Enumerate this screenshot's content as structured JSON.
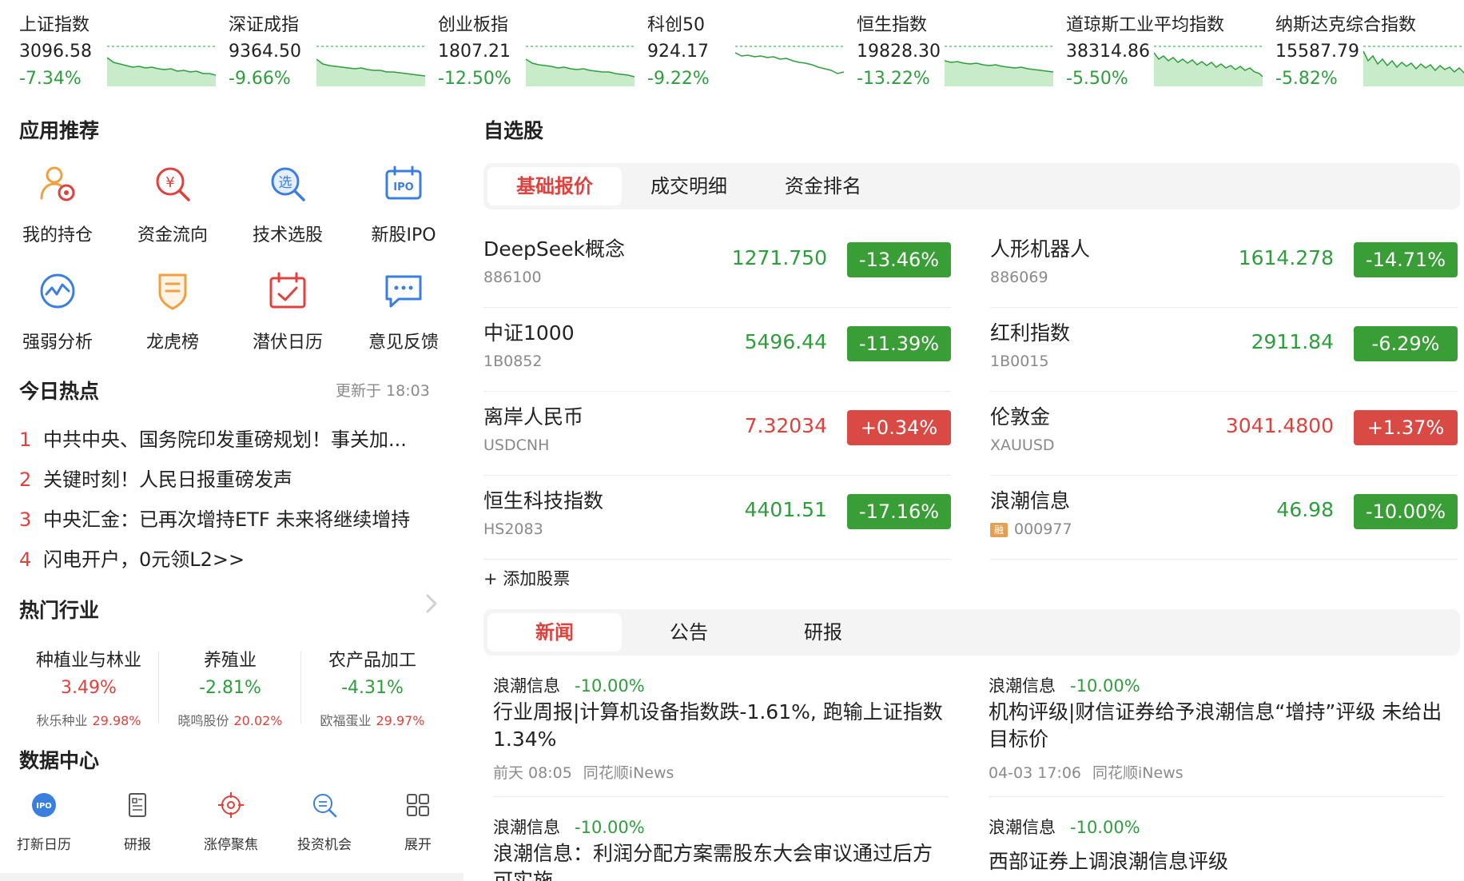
{
  "indices": [
    {
      "name": "上证指数",
      "value": "3096.58",
      "change": "-7.34%"
    },
    {
      "name": "深证成指",
      "value": "9364.50",
      "change": "-9.66%"
    },
    {
      "name": "创业板指",
      "value": "1807.21",
      "change": "-12.50%"
    },
    {
      "name": "科创50",
      "value": "924.17",
      "change": "-9.22%"
    },
    {
      "name": "恒生指数",
      "value": "19828.30",
      "change": "-13.22%"
    },
    {
      "name": "道琼斯工业平均指数",
      "value": "38314.86",
      "change": "-5.50%"
    },
    {
      "name": "纳斯达克综合指数",
      "value": "15587.79",
      "change": "-5.82%"
    }
  ],
  "apps": {
    "title": "应用推荐",
    "items": [
      {
        "label": "我的持仓",
        "icon": "portfolio-icon"
      },
      {
        "label": "资金流向",
        "icon": "money-flow-icon"
      },
      {
        "label": "技术选股",
        "icon": "stock-screener-icon"
      },
      {
        "label": "新股IPO",
        "icon": "ipo-icon"
      },
      {
        "label": "强弱分析",
        "icon": "strength-analysis-icon"
      },
      {
        "label": "龙虎榜",
        "icon": "dragon-tiger-icon"
      },
      {
        "label": "潜伏日历",
        "icon": "calendar-icon"
      },
      {
        "label": "意见反馈",
        "icon": "feedback-icon"
      }
    ],
    "ipo_badge": "IPO",
    "screener_badge": "选"
  },
  "hot": {
    "title": "今日热点",
    "updated": "更新于 18:03",
    "items": [
      {
        "rank": "1",
        "text": "中共中央、国务院印发重磅规划！事关加..."
      },
      {
        "rank": "2",
        "text": "关键时刻！人民日报重磅发声"
      },
      {
        "rank": "3",
        "text": "中央汇金：已再次增持ETF 未来将继续增持"
      },
      {
        "rank": "4",
        "text": "闪电开户，0元领L2>>"
      }
    ]
  },
  "industries": {
    "title": "热门行业",
    "items": [
      {
        "name": "种植业与林业",
        "change": "3.49%",
        "lead": "秋乐种业",
        "lead_change": "29.98%"
      },
      {
        "name": "养殖业",
        "change": "-2.81%",
        "lead": "晓鸣股份",
        "lead_change": "20.02%"
      },
      {
        "name": "农产品加工",
        "change": "-4.31%",
        "lead": "欧福蛋业",
        "lead_change": "29.97%"
      }
    ]
  },
  "data_center": {
    "title": "数据中心",
    "items": [
      {
        "label": "打新日历",
        "icon": "ipo-calendar-icon"
      },
      {
        "label": "研报",
        "icon": "report-icon"
      },
      {
        "label": "涨停聚焦",
        "icon": "target-icon"
      },
      {
        "label": "投资机会",
        "icon": "opportunity-search-icon"
      },
      {
        "label": "展开",
        "icon": "grid-icon"
      }
    ],
    "ipo_badge": "IPO"
  },
  "watchlist": {
    "title": "自选股",
    "tabs": [
      "基础报价",
      "成交明细",
      "资金排名"
    ],
    "active_tab": 0,
    "stocks": [
      {
        "name": "DeepSeek概念",
        "code": "886100",
        "price": "1271.750",
        "pct": "-13.46%",
        "dir": "down"
      },
      {
        "name": "人形机器人",
        "code": "886069",
        "price": "1614.278",
        "pct": "-14.71%",
        "dir": "down"
      },
      {
        "name": "中证1000",
        "code": "1B0852",
        "price": "5496.44",
        "pct": "-11.39%",
        "dir": "down"
      },
      {
        "name": "红利指数",
        "code": "1B0015",
        "price": "2911.84",
        "pct": "-6.29%",
        "dir": "down"
      },
      {
        "name": "离岸人民币",
        "code": "USDCNH",
        "price": "7.32034",
        "pct": "+0.34%",
        "dir": "up"
      },
      {
        "name": "伦敦金",
        "code": "XAUUSD",
        "price": "3041.4800",
        "pct": "+1.37%",
        "dir": "up"
      },
      {
        "name": "恒生科技指数",
        "code": "HS2083",
        "price": "4401.51",
        "pct": "-17.16%",
        "dir": "down"
      },
      {
        "name": "浪潮信息",
        "code": "000977",
        "price": "46.98",
        "pct": "-10.00%",
        "dir": "down",
        "badge": "融"
      }
    ],
    "add_label": "+ 添加股票"
  },
  "news": {
    "tabs": [
      "新闻",
      "公告",
      "研报"
    ],
    "active_tab": 0,
    "items": [
      {
        "stock": "浪潮信息",
        "change": "-10.00%",
        "title": "行业周报|计算机设备指数跌-1.61%, 跑输上证指数1.34%",
        "time": "前天 08:05",
        "source": "同花顺iNews"
      },
      {
        "stock": "浪潮信息",
        "change": "-10.00%",
        "title": "机构评级|财信证券给予浪潮信息“增持”评级 未给出目标价",
        "time": "04-03 17:06",
        "source": "同花顺iNews"
      },
      {
        "stock": "浪潮信息",
        "change": "-10.00%",
        "title": "浪潮信息：利润分配方案需股东大会审议通过后方可实施"
      },
      {
        "stock": "浪潮信息",
        "change": "-10.00%",
        "title": "西部证券上调浪潮信息评级"
      }
    ]
  },
  "colors": {
    "up": "#e0413c",
    "down": "#2e9e3d",
    "down_badge": "#3a9e37",
    "up_badge": "#d94a45",
    "accent": "#e0413c",
    "icon_orange": "#f0a040",
    "icon_blue": "#3a7fe0",
    "icon_red": "#e0413c"
  }
}
